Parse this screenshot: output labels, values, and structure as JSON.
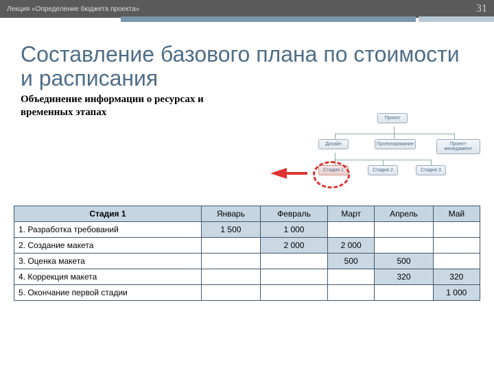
{
  "header": {
    "lecture": "Лекция «Определение бюджета проекта»",
    "page": "31"
  },
  "title": "Составление базового плана по стоимости и расписания",
  "subtitle": "Объединение информации о ресурсах и временных этапах",
  "org": {
    "root": "Проект",
    "level1": [
      "Дизайн",
      "Проектирование",
      "Проект-менеджмент"
    ],
    "level2": [
      "Стадия 1",
      "Стадия 2",
      "Стадия 3"
    ]
  },
  "table": {
    "stage_header": "Стадия 1",
    "months": [
      "Январь",
      "Февраль",
      "Март",
      "Апрель",
      "Май"
    ],
    "rows": [
      {
        "label": "1. Разработка требований",
        "vals": [
          "1 500",
          "1 000",
          "",
          "",
          ""
        ]
      },
      {
        "label": "2. Создание макета",
        "vals": [
          "",
          "2 000",
          "2 000",
          "",
          ""
        ]
      },
      {
        "label": "3. Оценка макета",
        "vals": [
          "",
          "",
          "500",
          "500",
          ""
        ]
      },
      {
        "label": "4. Коррекция макета",
        "vals": [
          "",
          "",
          "",
          "320",
          "320"
        ]
      },
      {
        "label": "5. Окончание первой стадии",
        "vals": [
          "",
          "",
          "",
          "",
          "1 000"
        ]
      }
    ]
  },
  "chart_data": {
    "type": "table",
    "title": "Стадия 1 — распределение стоимости по месяцам",
    "categories": [
      "Январь",
      "Февраль",
      "Март",
      "Апрель",
      "Май"
    ],
    "series": [
      {
        "name": "1. Разработка требований",
        "values": [
          1500,
          1000,
          null,
          null,
          null
        ]
      },
      {
        "name": "2. Создание макета",
        "values": [
          null,
          2000,
          2000,
          null,
          null
        ]
      },
      {
        "name": "3. Оценка макета",
        "values": [
          null,
          null,
          500,
          500,
          null
        ]
      },
      {
        "name": "4. Коррекция макета",
        "values": [
          null,
          null,
          null,
          320,
          320
        ]
      },
      {
        "name": "5. Окончание первой стадии",
        "values": [
          null,
          null,
          null,
          null,
          1000
        ]
      }
    ]
  }
}
